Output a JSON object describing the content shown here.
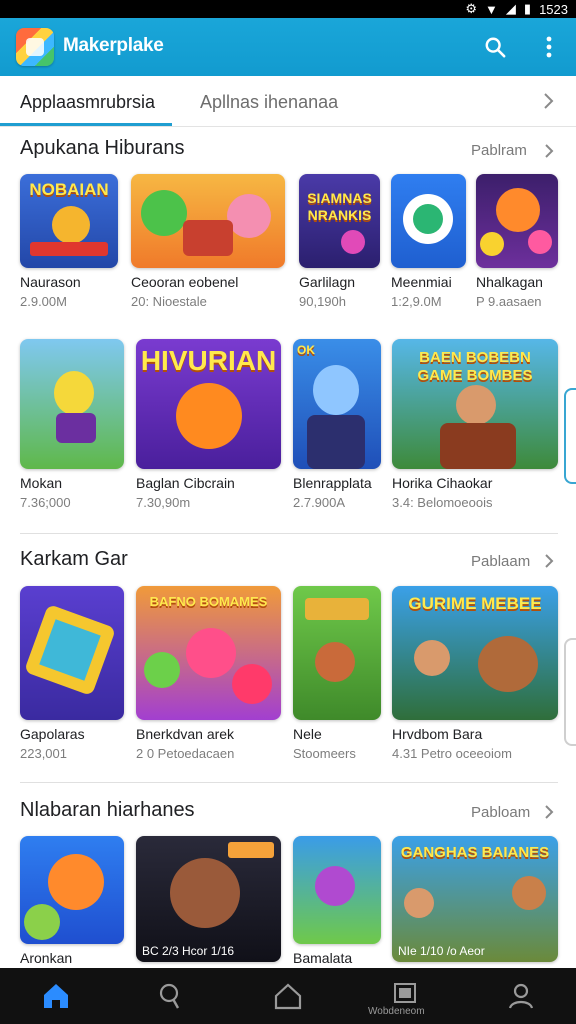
{
  "status": {
    "time": "1523"
  },
  "app": {
    "name": "Makerplake"
  },
  "tabs": [
    {
      "label": "Applaasmrubrsia"
    },
    {
      "label": "Apllnas ihenanaa"
    }
  ],
  "sections": [
    {
      "title": "Apukana Hiburans",
      "more": "Pablram",
      "items": [
        {
          "name": "Naurason",
          "meta": "2.9.00M",
          "art": "NOBAIAN"
        },
        {
          "name": "Ceooran eobenel",
          "meta": "20: Nioestale",
          "art": ""
        },
        {
          "name": "Garlilagn",
          "meta": "90,190h",
          "art": "SIAMNAS NRANKIS"
        },
        {
          "name": "Meenmiai",
          "meta": "1:2,9.0M",
          "art": ""
        },
        {
          "name": "Nhalkagan",
          "meta": "P 9.aasaen",
          "art": ""
        }
      ]
    },
    {
      "title": "",
      "more": "",
      "items": [
        {
          "name": "Mokan",
          "meta": "7.36;000",
          "art": ""
        },
        {
          "name": "Baglan Cibcrain",
          "meta": "7.30,90m",
          "art": "HIVURIAN"
        },
        {
          "name": "Blenrapplata",
          "meta": "2.7.900A",
          "art": "OK"
        },
        {
          "name": "Horika Cihaokar",
          "meta": "3.4: Belomoeoois",
          "art": "BAEN BOBEBN GAME BOMBES"
        }
      ]
    },
    {
      "title": "Karkam Gar",
      "more": "Pablaam",
      "items": [
        {
          "name": "Gapolaras",
          "meta": "223,001",
          "art": ""
        },
        {
          "name": "Bnerkdvan arek",
          "meta": "2 0 Petoedacaen",
          "art": "BAFNO BOMAMES"
        },
        {
          "name": "Nele",
          "meta": "Stoomeers",
          "art": ""
        },
        {
          "name": "Hrvdbom Bara",
          "meta": "4.31 Petro oceeoiom",
          "art": "GURIME MEBEE"
        }
      ]
    },
    {
      "title": "Nlabaran hiarhanes",
      "more": "Pabloam",
      "items": [
        {
          "name": "Aronkan",
          "meta": "",
          "art": ""
        },
        {
          "name": "",
          "meta": "",
          "art": "BC 2/3 Hcor 1/16"
        },
        {
          "name": "Bamalata",
          "meta": "",
          "art": ""
        },
        {
          "name": "",
          "meta": "",
          "art": "NIe 1/10 /o Aeor"
        }
      ]
    }
  ],
  "nav": {
    "label4": "Wobdeneom"
  },
  "colors": {
    "accent": "#1aa6d9",
    "navbar": "#111111"
  }
}
